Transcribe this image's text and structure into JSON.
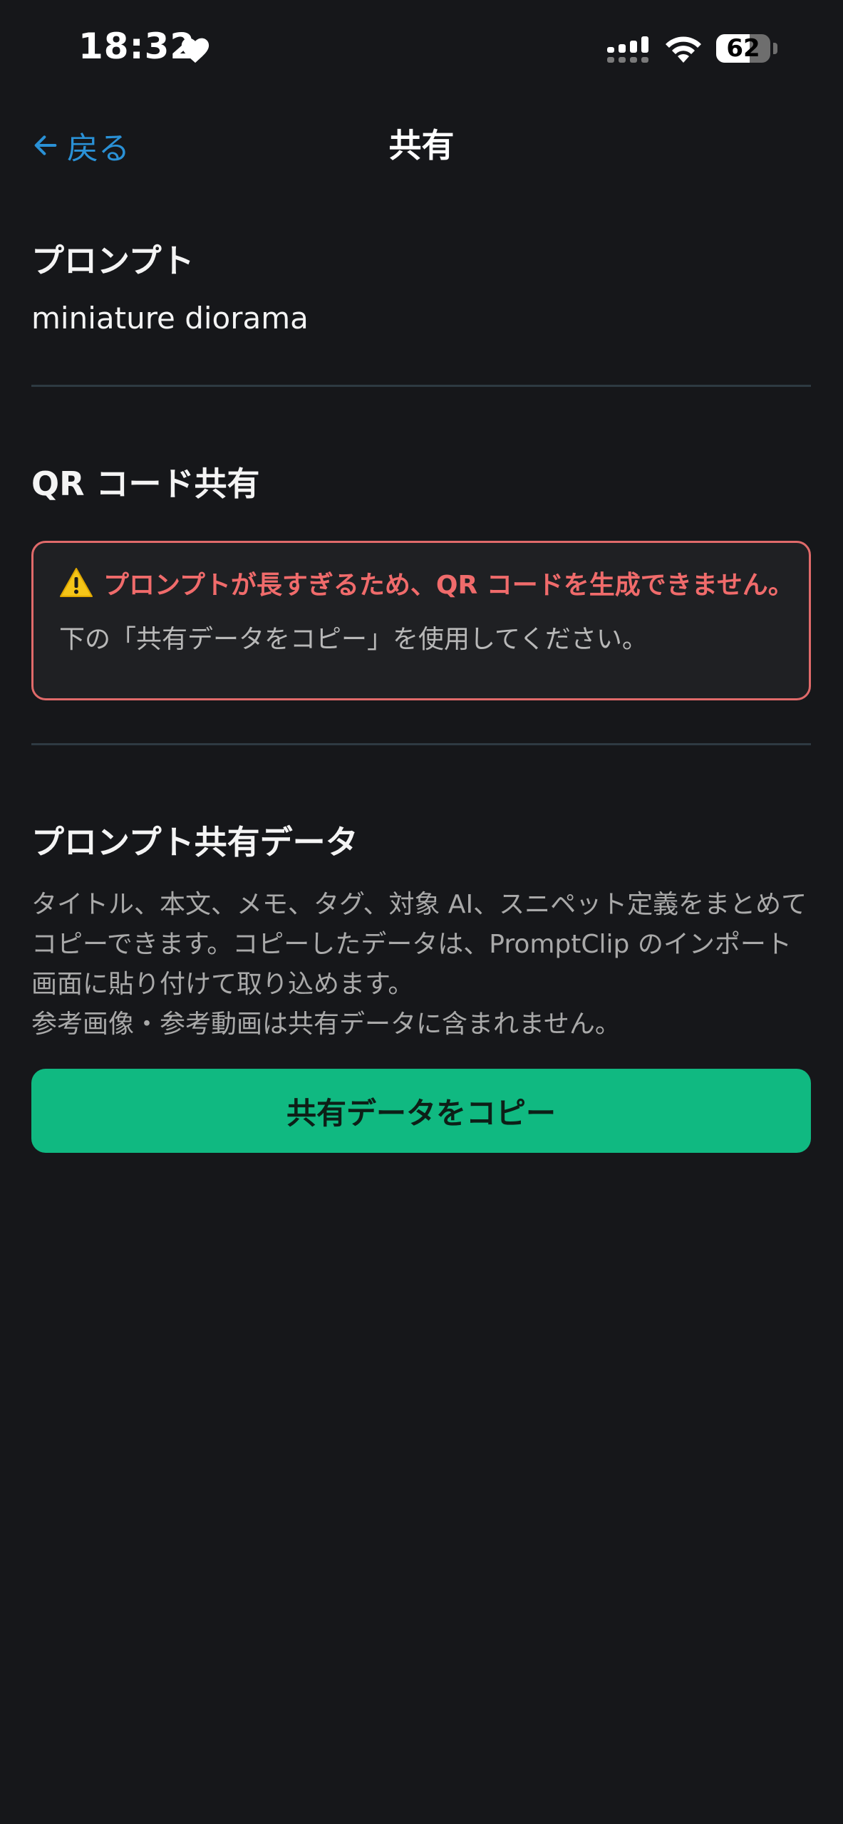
{
  "status_bar": {
    "time": "18:32",
    "battery_level": "62"
  },
  "nav": {
    "back_label": "戻る",
    "title": "共有"
  },
  "prompt_section": {
    "heading": "プロンプト",
    "value": "miniature diorama"
  },
  "qr_section": {
    "heading": "QR コード共有",
    "warning_title": "プロンプトが長すぎるため、QR コードを生成できません。",
    "warning_message": "下の「共有データをコピー」を使用してください。"
  },
  "share_section": {
    "heading": "プロンプト共有データ",
    "description_1": "タイトル、本文、メモ、タグ、対象 AI、スニペット定義をまとめてコピーできます。コピーしたデータは、PromptClip のインポート画面に貼り付けて取り込めます。",
    "description_2": "参考画像・参考動画は共有データに含まれません。",
    "copy_button_label": "共有データをコピー"
  },
  "colors": {
    "background": "#16171a",
    "accent_link": "#2a91d6",
    "warning": "#f06b6b",
    "primary_button": "#10b981"
  },
  "icons": {
    "back": "arrow-left-icon",
    "warning": "warning-triangle-icon",
    "heart": "heart-icon",
    "signal": "cellular-signal-icon",
    "wifi": "wifi-icon",
    "battery": "battery-icon"
  }
}
